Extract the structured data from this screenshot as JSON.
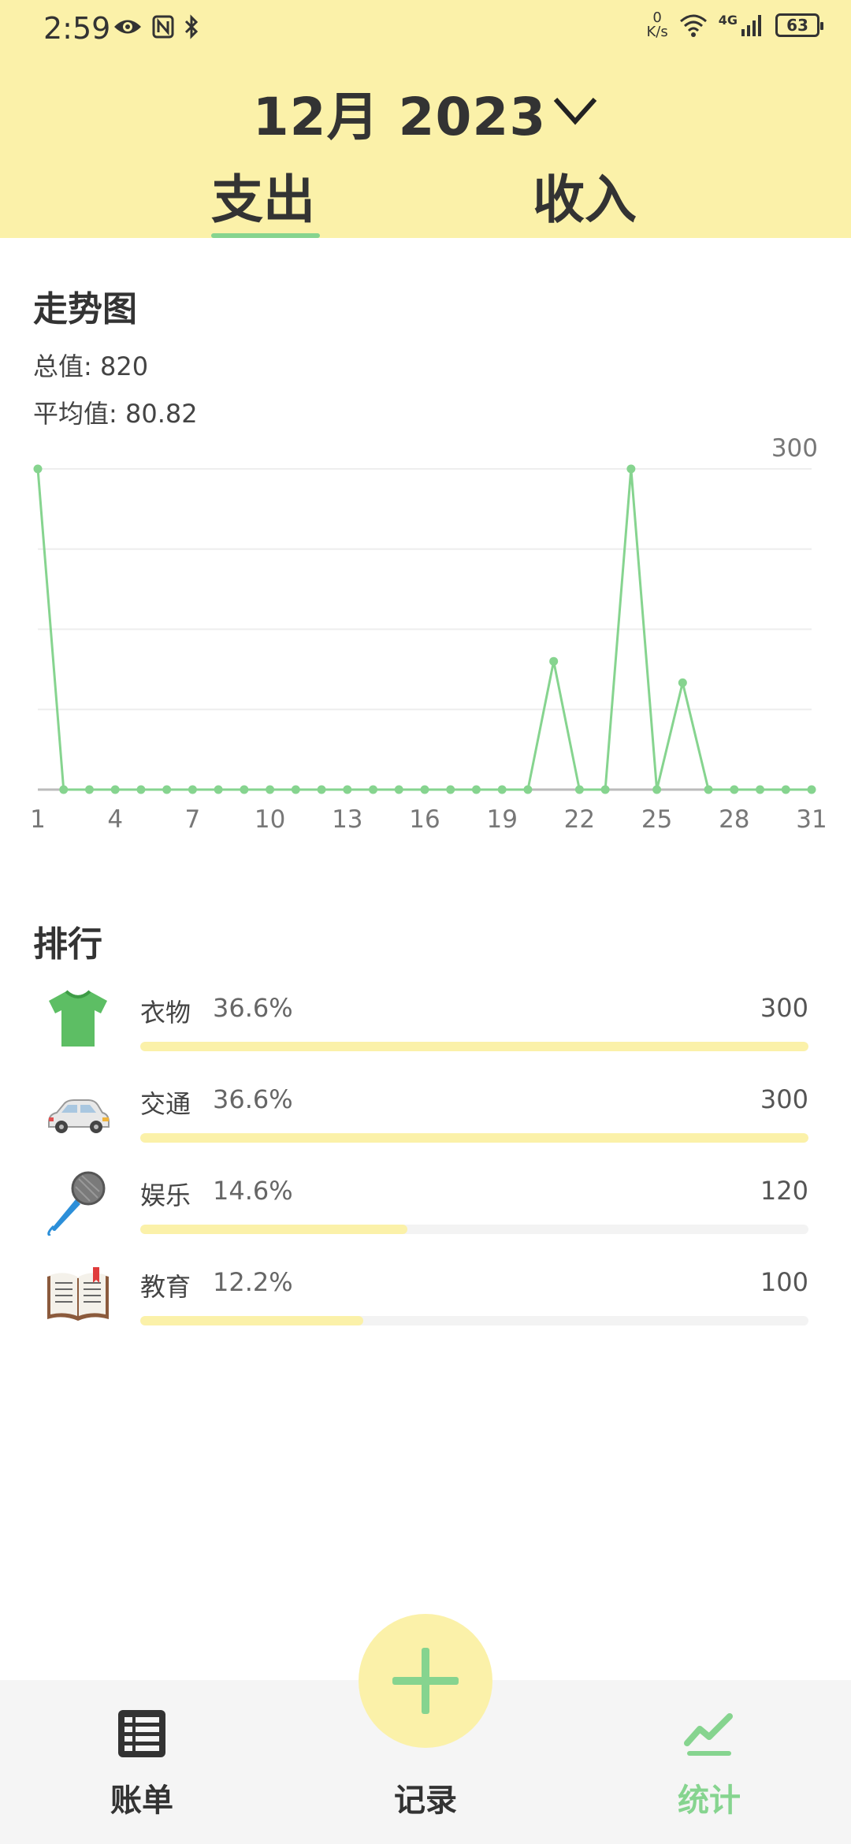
{
  "status_bar": {
    "time": "2:59",
    "net_speed_value": "0",
    "net_speed_unit": "K/s",
    "network_type": "4G",
    "battery": "63"
  },
  "header": {
    "month": "12月 2023",
    "tabs": [
      "支出",
      "收入"
    ],
    "active_tab": "支出"
  },
  "trend": {
    "title": "走势图",
    "total_label": "总值:",
    "total_value": "820",
    "avg_label": "平均值:",
    "avg_value": "80.82"
  },
  "chart_data": {
    "type": "line",
    "x": [
      1,
      2,
      3,
      4,
      5,
      6,
      7,
      8,
      9,
      10,
      11,
      12,
      13,
      14,
      15,
      16,
      17,
      18,
      19,
      20,
      21,
      22,
      23,
      24,
      25,
      26,
      27,
      28,
      29,
      30,
      31
    ],
    "series": [
      {
        "values": [
          300,
          0,
          0,
          0,
          0,
          0,
          0,
          0,
          0,
          0,
          0,
          0,
          0,
          0,
          0,
          0,
          0,
          0,
          0,
          0,
          120,
          0,
          0,
          300,
          0,
          100,
          0,
          0,
          0,
          0,
          0
        ]
      }
    ],
    "x_ticks": [
      "1",
      "4",
      "7",
      "10",
      "13",
      "16",
      "19",
      "22",
      "25",
      "28",
      "31"
    ],
    "y_max_label": "300",
    "ylim": [
      0,
      300
    ],
    "grid": true,
    "color": "#86D48F"
  },
  "ranking": {
    "title": "排行",
    "items": [
      {
        "icon": "tshirt-icon",
        "name": "衣物",
        "percent": "36.6%",
        "value": "300",
        "fraction": 1.0
      },
      {
        "icon": "car-icon",
        "name": "交通",
        "percent": "36.6%",
        "value": "300",
        "fraction": 1.0
      },
      {
        "icon": "microphone-icon",
        "name": "娱乐",
        "percent": "14.6%",
        "value": "120",
        "fraction": 0.4
      },
      {
        "icon": "book-icon",
        "name": "教育",
        "percent": "12.2%",
        "value": "100",
        "fraction": 0.3333
      }
    ],
    "bar_color": "#FBF1A9"
  },
  "bottom_nav": {
    "bill_label": "账单",
    "record_label": "记录",
    "stats_label": "统计",
    "active": "统计"
  },
  "colors": {
    "header_bg": "#FBF1A9",
    "accent": "#86D48F",
    "nav_bg": "#F5F5F5"
  }
}
